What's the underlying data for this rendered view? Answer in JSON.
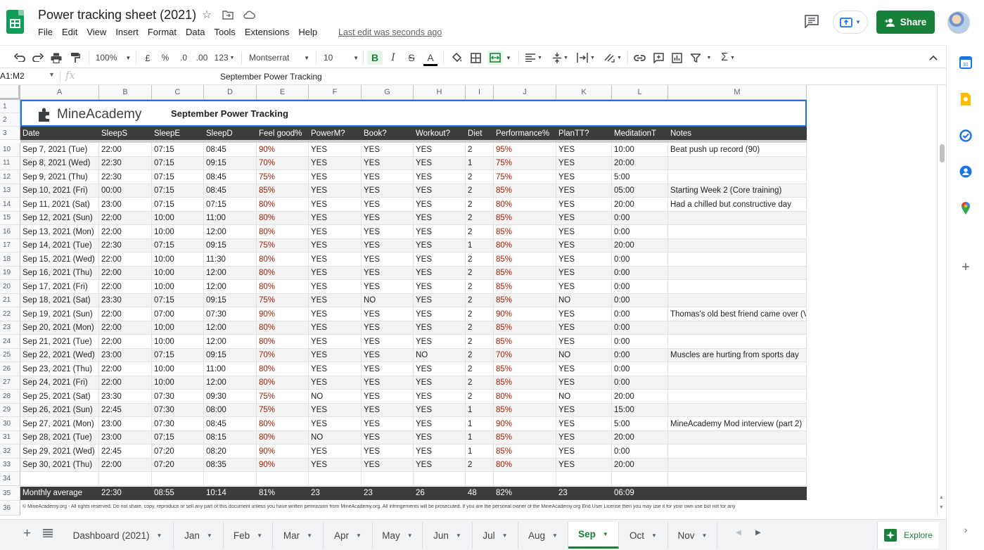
{
  "doc": {
    "title": "Power tracking sheet (2021)",
    "last_edit": "Last edit was seconds ago",
    "share_label": "Share"
  },
  "menu": [
    "File",
    "Edit",
    "View",
    "Insert",
    "Format",
    "Data",
    "Tools",
    "Extensions",
    "Help"
  ],
  "toolbar": {
    "zoom": "100%",
    "currency": "£",
    "percent": "%",
    "dec_decrease": ".0",
    "dec_increase": ".00",
    "format_more": "123",
    "font": "Montserrat",
    "font_size": "10",
    "bold": "B",
    "italic": "I",
    "strike": "S",
    "text_color": "A"
  },
  "formula_bar": {
    "name_box": "A1:M2",
    "fx": "fx",
    "value": "September Power Tracking"
  },
  "columns": [
    "A",
    "B",
    "C",
    "D",
    "E",
    "F",
    "G",
    "H",
    "I",
    "J",
    "K",
    "L",
    "M"
  ],
  "sheet": {
    "brand": "MineAcademy",
    "heading": "September Power Tracking",
    "headers": [
      "Date",
      "SleepS",
      "SleepE",
      "SleepD",
      "Feel good%",
      "PowerM?",
      "Book?",
      "Workout?",
      "Diet",
      "Performance%",
      "PlanTT?",
      "MeditationT",
      "Notes"
    ],
    "rows": [
      {
        "n": "10",
        "cells": [
          "Sep 7, 2021 (Tue)",
          "22:00",
          "07:15",
          "08:45",
          "90%",
          "YES",
          "YES",
          "YES",
          "2",
          "95%",
          "YES",
          "10:00",
          "Beat push up record (90)"
        ]
      },
      {
        "n": "11",
        "cells": [
          "Sep 8, 2021 (Wed)",
          "22:30",
          "07:15",
          "09:15",
          "70%",
          "YES",
          "YES",
          "YES",
          "1",
          "75%",
          "YES",
          "20:00",
          ""
        ]
      },
      {
        "n": "12",
        "cells": [
          "Sep 9, 2021 (Thu)",
          "22:30",
          "07:15",
          "08:45",
          "75%",
          "YES",
          "YES",
          "YES",
          "2",
          "75%",
          "YES",
          "5:00",
          ""
        ]
      },
      {
        "n": "13",
        "cells": [
          "Sep 10, 2021 (Fri)",
          "00:00",
          "07:15",
          "08:45",
          "85%",
          "YES",
          "YES",
          "YES",
          "2",
          "85%",
          "YES",
          "05:00",
          "Starting Week 2 (Core training)"
        ]
      },
      {
        "n": "14",
        "cells": [
          "Sep 11, 2021 (Sat)",
          "23:00",
          "07:15",
          "07:15",
          "80%",
          "YES",
          "YES",
          "YES",
          "2",
          "80%",
          "YES",
          "20:00",
          "Had a chilled but constructive day"
        ]
      },
      {
        "n": "15",
        "cells": [
          "Sep 12, 2021 (Sun)",
          "22:00",
          "10:00",
          "11:00",
          "80%",
          "YES",
          "YES",
          "YES",
          "2",
          "85%",
          "YES",
          "0:00",
          ""
        ]
      },
      {
        "n": "16",
        "cells": [
          "Sep 13, 2021 (Mon)",
          "22:00",
          "10:00",
          "12:00",
          "80%",
          "YES",
          "YES",
          "YES",
          "2",
          "85%",
          "YES",
          "0:00",
          ""
        ]
      },
      {
        "n": "17",
        "cells": [
          "Sep 14, 2021 (Tue)",
          "22:30",
          "07:15",
          "09:15",
          "75%",
          "YES",
          "YES",
          "YES",
          "1",
          "80%",
          "YES",
          "20:00",
          ""
        ]
      },
      {
        "n": "18",
        "cells": [
          "Sep 15, 2021 (Wed)",
          "22:00",
          "10:00",
          "11:30",
          "80%",
          "YES",
          "YES",
          "YES",
          "2",
          "85%",
          "YES",
          "0:00",
          ""
        ]
      },
      {
        "n": "19",
        "cells": [
          "Sep 16, 2021 (Thu)",
          "22:00",
          "10:00",
          "12:00",
          "80%",
          "YES",
          "YES",
          "YES",
          "2",
          "85%",
          "YES",
          "0:00",
          ""
        ]
      },
      {
        "n": "20",
        "cells": [
          "Sep 17, 2021 (Fri)",
          "22:00",
          "10:00",
          "12:00",
          "80%",
          "YES",
          "YES",
          "YES",
          "2",
          "85%",
          "YES",
          "0:00",
          ""
        ]
      },
      {
        "n": "21",
        "cells": [
          "Sep 18, 2021 (Sat)",
          "23:30",
          "07:15",
          "09:15",
          "75%",
          "YES",
          "NO",
          "YES",
          "2",
          "85%",
          "NO",
          "0:00",
          ""
        ]
      },
      {
        "n": "22",
        "cells": [
          "Sep 19, 2021 (Sun)",
          "22:00",
          "07:00",
          "07:30",
          "90%",
          "YES",
          "YES",
          "YES",
          "2",
          "90%",
          "YES",
          "0:00",
          "Thomas's old best friend came over (Vi"
        ]
      },
      {
        "n": "23",
        "cells": [
          "Sep 20, 2021 (Mon)",
          "22:00",
          "10:00",
          "12:00",
          "80%",
          "YES",
          "YES",
          "YES",
          "2",
          "85%",
          "YES",
          "0:00",
          ""
        ]
      },
      {
        "n": "24",
        "cells": [
          "Sep 21, 2021 (Tue)",
          "22:00",
          "10:00",
          "12:00",
          "80%",
          "YES",
          "YES",
          "YES",
          "2",
          "85%",
          "YES",
          "0:00",
          ""
        ]
      },
      {
        "n": "25",
        "cells": [
          "Sep 22, 2021 (Wed)",
          "23:00",
          "07:15",
          "09:15",
          "70%",
          "YES",
          "YES",
          "NO",
          "2",
          "70%",
          "NO",
          "0:00",
          "Muscles are hurting from sports day"
        ]
      },
      {
        "n": "26",
        "cells": [
          "Sep 23, 2021 (Thu)",
          "22:00",
          "10:00",
          "11:00",
          "80%",
          "YES",
          "YES",
          "YES",
          "2",
          "85%",
          "YES",
          "0:00",
          ""
        ]
      },
      {
        "n": "27",
        "cells": [
          "Sep 24, 2021 (Fri)",
          "22:00",
          "10:00",
          "12:00",
          "80%",
          "YES",
          "YES",
          "YES",
          "2",
          "85%",
          "YES",
          "0:00",
          ""
        ]
      },
      {
        "n": "28",
        "cells": [
          "Sep 25, 2021 (Sat)",
          "23:30",
          "07:30",
          "09:30",
          "75%",
          "NO",
          "YES",
          "YES",
          "2",
          "80%",
          "NO",
          "20:00",
          ""
        ]
      },
      {
        "n": "29",
        "cells": [
          "Sep 26, 2021 (Sun)",
          "22:45",
          "07:30",
          "08:00",
          "75%",
          "YES",
          "YES",
          "YES",
          "1",
          "85%",
          "YES",
          "15:00",
          ""
        ]
      },
      {
        "n": "30",
        "cells": [
          "Sep 27, 2021 (Mon)",
          "23:00",
          "07:30",
          "08:45",
          "80%",
          "YES",
          "YES",
          "YES",
          "1",
          "90%",
          "YES",
          "5:00",
          "MineAcademy Mod interview (part 2)"
        ]
      },
      {
        "n": "31",
        "cells": [
          "Sep 28, 2021 (Tue)",
          "23:00",
          "07:15",
          "08:15",
          "80%",
          "NO",
          "YES",
          "YES",
          "1",
          "85%",
          "YES",
          "20:00",
          ""
        ]
      },
      {
        "n": "32",
        "cells": [
          "Sep 29, 2021 (Wed)",
          "22:45",
          "07:20",
          "08:20",
          "90%",
          "YES",
          "YES",
          "YES",
          "1",
          "85%",
          "YES",
          "0:00",
          ""
        ]
      },
      {
        "n": "33",
        "cells": [
          "Sep 30, 2021 (Thu)",
          "22:00",
          "07:20",
          "08:35",
          "90%",
          "YES",
          "YES",
          "YES",
          "2",
          "80%",
          "YES",
          "20:00",
          ""
        ]
      },
      {
        "n": "34",
        "cells": [
          "",
          "",
          "",
          "",
          "",
          "",
          "",
          "",
          "",
          "",
          "",
          "",
          ""
        ]
      }
    ],
    "average": {
      "n": "35",
      "cells": [
        "Monthly average",
        "22:30",
        "08:55",
        "10:14",
        "81%",
        "23",
        "23",
        "26",
        "48",
        "82%",
        "23",
        "06:09",
        ""
      ]
    },
    "footer_row": "36",
    "footer_note": "© MineAcademy.org - All rights reserved. Do not share, copy, reproduce or sell any part of this document unless you have written permission from MineAcademy.org. All infringements will be prosecuted. If you are the personal owner of the MineAcademy.org End User License then you may use it for your own use but not for any"
  },
  "tabs": [
    "Dashboard (2021)",
    "Jan",
    "Feb",
    "Mar",
    "Apr",
    "May",
    "Jun",
    "Jul",
    "Aug",
    "Sep",
    "Oct",
    "Nov"
  ],
  "active_tab": "Sep",
  "explore_label": "Explore",
  "colors": {
    "brand_green": "#188038",
    "header_dark": "#3c3c3c",
    "percent_red": "#a61c00",
    "selection_blue": "#1a73e8"
  }
}
